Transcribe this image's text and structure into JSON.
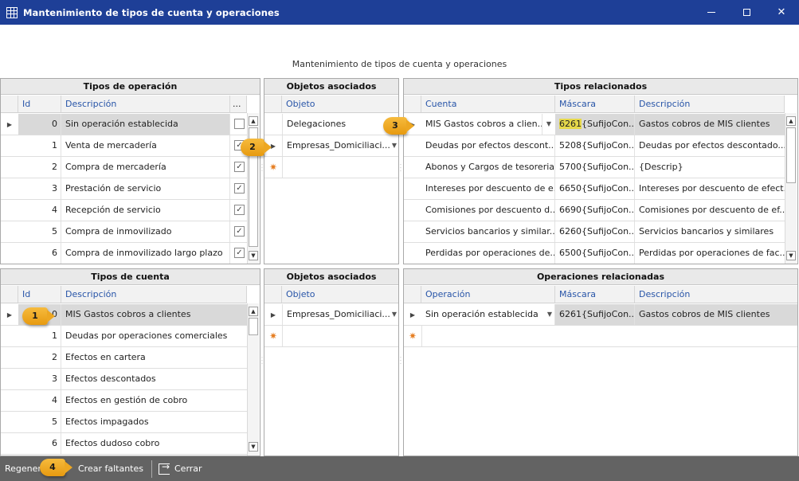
{
  "window": {
    "title": "Mantenimiento de tipos de cuenta y operaciones"
  },
  "header_label": "Mantenimiento de tipos de cuenta y operaciones",
  "tipos_operacion": {
    "title": "Tipos de operación",
    "columns": [
      "Id",
      "Descripción",
      "..."
    ],
    "rows": [
      {
        "id": "0",
        "desc": "Sin operación establecida",
        "checked": false
      },
      {
        "id": "1",
        "desc": "Venta de mercadería",
        "checked": true
      },
      {
        "id": "2",
        "desc": "Compra de mercadería",
        "checked": true
      },
      {
        "id": "3",
        "desc": "Prestación de servicio",
        "checked": true
      },
      {
        "id": "4",
        "desc": "Recepción de servicio",
        "checked": true
      },
      {
        "id": "5",
        "desc": "Compra de inmovilizado",
        "checked": true
      },
      {
        "id": "6",
        "desc": "Compra de inmovilizado largo plazo",
        "checked": true
      }
    ]
  },
  "objetos_asociados_top": {
    "title": "Objetos asociados",
    "column": "Objeto",
    "rows": [
      "Delegaciones",
      "Empresas_Domiciliaci..."
    ]
  },
  "tipos_relacionados": {
    "title": "Tipos relacionados",
    "columns": [
      "Cuenta",
      "Máscara",
      "Descripción"
    ],
    "rows": [
      {
        "cuenta": "MIS Gastos cobros a clien...",
        "mask_code": "6261",
        "mask_rest": "{SufijoCon...",
        "desc": "Gastos cobros de MIS clientes"
      },
      {
        "cuenta": "Deudas por efectos descont...",
        "mask_code": "5208",
        "mask_rest": "{SufijoCon...",
        "desc": "Deudas por efectos descontado..."
      },
      {
        "cuenta": "Abonos y Cargos de tesoreria",
        "mask_code": "5700",
        "mask_rest": "{SufijoCon...",
        "desc": "{Descrip}"
      },
      {
        "cuenta": "Intereses por descuento de e...",
        "mask_code": "6650",
        "mask_rest": "{SufijoCon...",
        "desc": "Intereses por descuento de efect..."
      },
      {
        "cuenta": "Comisiones por descuento d...",
        "mask_code": "6690",
        "mask_rest": "{SufijoCon...",
        "desc": "Comisiones por descuento de ef..."
      },
      {
        "cuenta": "Servicios bancarios y similar...",
        "mask_code": "6260",
        "mask_rest": "{SufijoCon...",
        "desc": "Servicios bancarios y similares"
      },
      {
        "cuenta": "Perdidas por operaciones de...",
        "mask_code": "6500",
        "mask_rest": "{SufijoCon...",
        "desc": "Perdidas por operaciones de fac..."
      }
    ]
  },
  "tipos_cuenta": {
    "title": "Tipos de cuenta",
    "columns": [
      "Id",
      "Descripción"
    ],
    "rows": [
      {
        "id": "0",
        "desc": "MIS Gastos cobros a clientes"
      },
      {
        "id": "1",
        "desc": "Deudas por operaciones comerciales"
      },
      {
        "id": "2",
        "desc": "Efectos en cartera"
      },
      {
        "id": "3",
        "desc": "Efectos descontados"
      },
      {
        "id": "4",
        "desc": "Efectos en gestión de cobro"
      },
      {
        "id": "5",
        "desc": "Efectos impagados"
      },
      {
        "id": "6",
        "desc": "Efectos dudoso cobro"
      }
    ]
  },
  "objetos_asociados_bottom": {
    "title": "Objetos asociados",
    "column": "Objeto",
    "rows": [
      "Empresas_Domiciliaci..."
    ]
  },
  "operaciones_relacionadas": {
    "title": "Operaciones relacionadas",
    "columns": [
      "Operación",
      "Máscara",
      "Descripción"
    ],
    "rows": [
      {
        "operacion": "Sin operación establecida",
        "mascara": "6261{SufijoCon...",
        "desc": "Gastos cobros de MIS clientes"
      }
    ]
  },
  "toolbar": {
    "regenerar": "Regener",
    "crear": "Crear faltantes",
    "cerrar": "Cerrar"
  },
  "callouts": [
    "1",
    "2",
    "3",
    "4"
  ],
  "colors": {
    "titlebar": "#1e3f97",
    "callout": "#eda722",
    "highlight": "#e6d84a",
    "bottombar": "#636363"
  }
}
